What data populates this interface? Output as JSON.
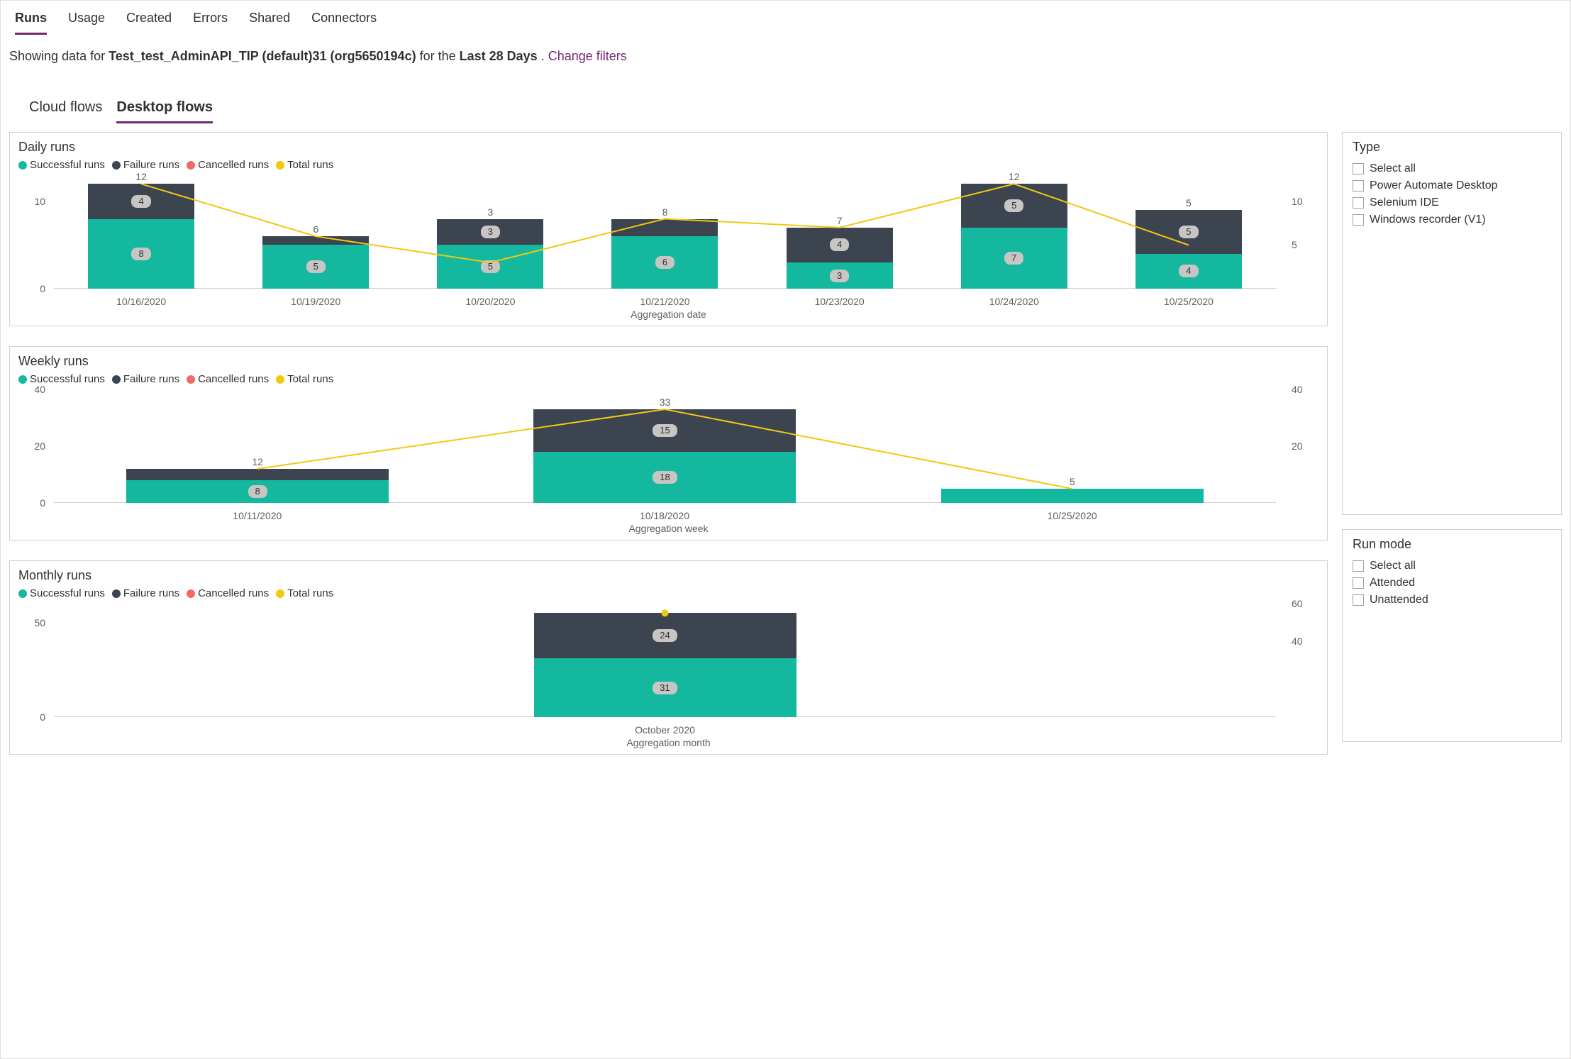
{
  "tabs": {
    "items": [
      "Runs",
      "Usage",
      "Created",
      "Errors",
      "Shared",
      "Connectors"
    ],
    "active": "Runs"
  },
  "filter_line": {
    "prefix": "Showing data for ",
    "env": "Test_test_AdminAPI_TIP (default)31 (org5650194c)",
    "mid": " for the ",
    "range": "Last 28 Days",
    "suffix": ". ",
    "link": "Change filters"
  },
  "sub_tabs": {
    "items": [
      "Cloud flows",
      "Desktop flows"
    ],
    "active": "Desktop flows"
  },
  "legend": {
    "success": "Successful runs",
    "failure": "Failure runs",
    "cancelled": "Cancelled runs",
    "total": "Total runs"
  },
  "colors": {
    "success": "#13b89e",
    "failure": "#3b444f",
    "cancelled": "#f06a6a",
    "total": "#f2c811"
  },
  "side": {
    "type": {
      "title": "Type",
      "items": [
        "Select all",
        "Power Automate Desktop",
        "Selenium IDE",
        "Windows recorder (V1)"
      ]
    },
    "runmode": {
      "title": "Run mode",
      "items": [
        "Select all",
        "Attended",
        "Unattended"
      ]
    }
  },
  "chart_data": [
    {
      "id": "daily",
      "title": "Daily runs",
      "type": "bar",
      "xlabel": "Aggregation date",
      "ylabel": "",
      "ylim": [
        0,
        13
      ],
      "y_ticks": [
        0,
        10
      ],
      "y2_ticks": [
        5,
        10
      ],
      "categories": [
        "10/16/2020",
        "10/19/2020",
        "10/20/2020",
        "10/21/2020",
        "10/23/2020",
        "10/24/2020",
        "10/25/2020"
      ],
      "series": [
        {
          "name": "Successful runs",
          "key": "success",
          "values": [
            8,
            5,
            5,
            6,
            3,
            7,
            4
          ]
        },
        {
          "name": "Failure runs",
          "key": "failure",
          "values": [
            4,
            1,
            3,
            2,
            4,
            5,
            5
          ]
        },
        {
          "name": "Total runs",
          "key": "total",
          "values": [
            12,
            6,
            3,
            8,
            7,
            12,
            5
          ]
        }
      ],
      "labels": {
        "success": [
          8,
          5,
          5,
          6,
          3,
          7,
          4
        ],
        "failure": [
          4,
          null,
          3,
          null,
          4,
          5,
          5
        ],
        "total": [
          12,
          6,
          3,
          8,
          7,
          12,
          5
        ]
      }
    },
    {
      "id": "weekly",
      "title": "Weekly runs",
      "type": "bar",
      "xlabel": "Aggregation week",
      "ylabel": "",
      "ylim": [
        0,
        40
      ],
      "y_ticks": [
        0,
        20,
        40
      ],
      "y2_ticks": [
        20,
        40
      ],
      "categories": [
        "10/11/2020",
        "10/18/2020",
        "10/25/2020"
      ],
      "series": [
        {
          "name": "Successful runs",
          "key": "success",
          "values": [
            8,
            18,
            5
          ]
        },
        {
          "name": "Failure runs",
          "key": "failure",
          "values": [
            4,
            15,
            0
          ]
        },
        {
          "name": "Total runs",
          "key": "total",
          "values": [
            12,
            33,
            5
          ]
        }
      ],
      "labels": {
        "success": [
          8,
          18,
          null
        ],
        "failure": [
          null,
          15,
          null
        ],
        "total": [
          12,
          33,
          5
        ]
      }
    },
    {
      "id": "monthly",
      "title": "Monthly runs",
      "type": "bar",
      "xlabel": "Aggregation month",
      "ylabel": "",
      "ylim": [
        0,
        60
      ],
      "y_ticks": [
        0,
        50
      ],
      "y2_ticks": [
        40,
        60
      ],
      "categories": [
        "October 2020"
      ],
      "series": [
        {
          "name": "Successful runs",
          "key": "success",
          "values": [
            31
          ]
        },
        {
          "name": "Failure runs",
          "key": "failure",
          "values": [
            24
          ]
        },
        {
          "name": "Total runs",
          "key": "total",
          "values": [
            55
          ]
        }
      ],
      "labels": {
        "success": [
          31
        ],
        "failure": [
          24
        ],
        "total": [
          null
        ]
      }
    }
  ]
}
